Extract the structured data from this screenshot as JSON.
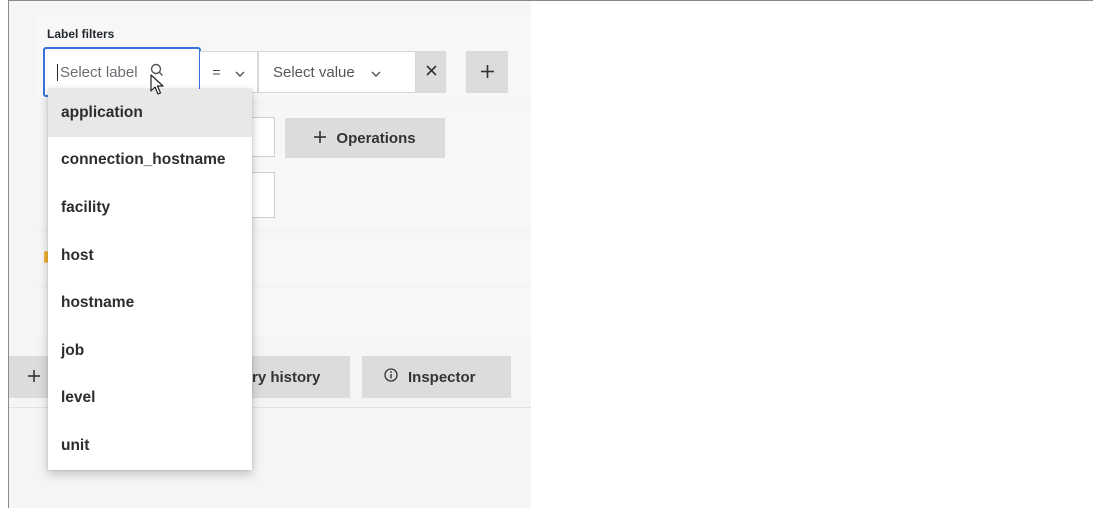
{
  "label_filters": {
    "title": "Label filters",
    "label_select": {
      "placeholder": "Select label",
      "icon": "search-icon"
    },
    "operator": {
      "value": "=",
      "icon": "chevron-down-icon"
    },
    "value_select": {
      "placeholder": "Select value",
      "icon": "chevron-down-icon"
    },
    "remove_icon": "close-icon",
    "add_icon": "plus-icon"
  },
  "operations": {
    "label": "Operations",
    "icon": "plus-icon"
  },
  "bottom_toolbar": {
    "add_icon": "plus-icon",
    "query_history_label": "ry history",
    "inspector_label": "Inspector",
    "inspector_icon": "info-icon"
  },
  "label_dropdown": {
    "options": [
      "application",
      "connection_hostname",
      "facility",
      "host",
      "hostname",
      "job",
      "level",
      "unit"
    ],
    "highlighted": "application"
  },
  "colors": {
    "focus_border": "#3871dc",
    "panel_bg": "#f4f5f5",
    "button_bg": "#dcdcdd",
    "highlight_bg": "#e8e8e9"
  }
}
